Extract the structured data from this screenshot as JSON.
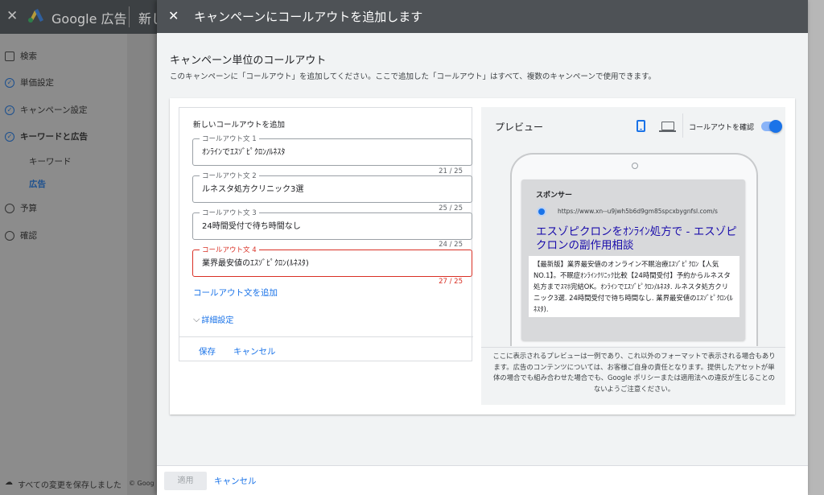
{
  "background_app": {
    "title": "Google 広告",
    "subtitle": "新し",
    "sidebar": [
      {
        "label": "検索",
        "icon": "search-square-icon"
      },
      {
        "label": "単価設定",
        "icon": "check-circle-icon"
      },
      {
        "label": "キャンペーン設定",
        "icon": "check-circle-icon"
      },
      {
        "label": "キーワードと広告",
        "icon": "check-circle-icon"
      },
      {
        "label": "キーワード",
        "icon": ""
      },
      {
        "label": "広告",
        "icon": ""
      },
      {
        "label": "予算",
        "icon": "empty-circle-icon"
      },
      {
        "label": "確認",
        "icon": "empty-circle-icon"
      }
    ],
    "footer": "すべての変更を保存しました",
    "footer_copyright": "© Goog"
  },
  "dialog": {
    "title": "キャンペーンにコールアウトを追加します",
    "section_title": "キャンペーン単位のコールアウト",
    "section_desc": "このキャンペーンに「コールアウト」を追加してください。ここで追加した「コールアウト」はすべて、複数のキャンペーンで使用できます。",
    "form": {
      "title": "新しいコールアウトを追加",
      "fields": [
        {
          "label": "コールアウト文 1",
          "value": "ｵﾝﾗｲﾝでｴｽｿﾞﾋﾟｸﾛﾝ/ﾙﾈｽﾀ",
          "counter": "21 / 25"
        },
        {
          "label": "コールアウト文 2",
          "value": "ルネスタ処方クリニック3選",
          "counter": "25 / 25"
        },
        {
          "label": "コールアウト文 3",
          "value": "24時間受付で待ち時間なし",
          "counter": "24 / 25"
        },
        {
          "label": "コールアウト文 4",
          "value": "業界最安値のｴｽｿﾞﾋﾟｸﾛﾝ(ﾙﾈｽﾀ)",
          "counter": "27 / 25"
        }
      ],
      "add_link": "コールアウト文を追加",
      "advanced": "詳細設定",
      "save": "保存",
      "cancel": "キャンセル"
    },
    "preview": {
      "title": "プレビュー",
      "toggle_label": "コールアウトを確認",
      "toggle_on": true,
      "ad": {
        "sponsor": "スポンサー",
        "url": "https://www.xn--u9jwh5b6d9gm85spcxbygnfsl.com/s",
        "headline": "エスゾピクロンをｵﾝﾗｲﾝ処方で - エスゾピクロンの副作用相談",
        "body": "【最新版】業界最安値のオンライン不眠治療ｴｽｿﾞﾋﾟｸﾛﾝ【人気NO.1】。不眠症ｵﾝﾗｲﾝｸﾘﾆｯｸ比較【24時間受付】予約からルネスタ処方までｽﾏﾎ完結OK。ｵﾝﾗｲﾝでｴｽｿﾞﾋﾟｸﾛﾝ/ﾙﾈｽﾀ. ルネスタ処方クリニック3選. 24時間受付で待ち時間なし. 業界最安値のｴｽｿﾞﾋﾟｸﾛﾝ(ﾙﾈｽﾀ)."
      },
      "note": "ここに表示されるプレビューは一例であり、これ以外のフォーマットで表示される場合もあります。広告のコンテンツについては、お客様ご自身の責任となります。提供したアセットが単体の場合でも組み合わせた場合でも、Google ポリシーまたは適用法への違反が生じることのないようご注意ください。"
    },
    "bottom": {
      "apply": "適用",
      "cancel": "キャンセル"
    }
  },
  "colors": {
    "accent": "#1a73e8",
    "error": "#d93025",
    "header": "#4e5256"
  }
}
